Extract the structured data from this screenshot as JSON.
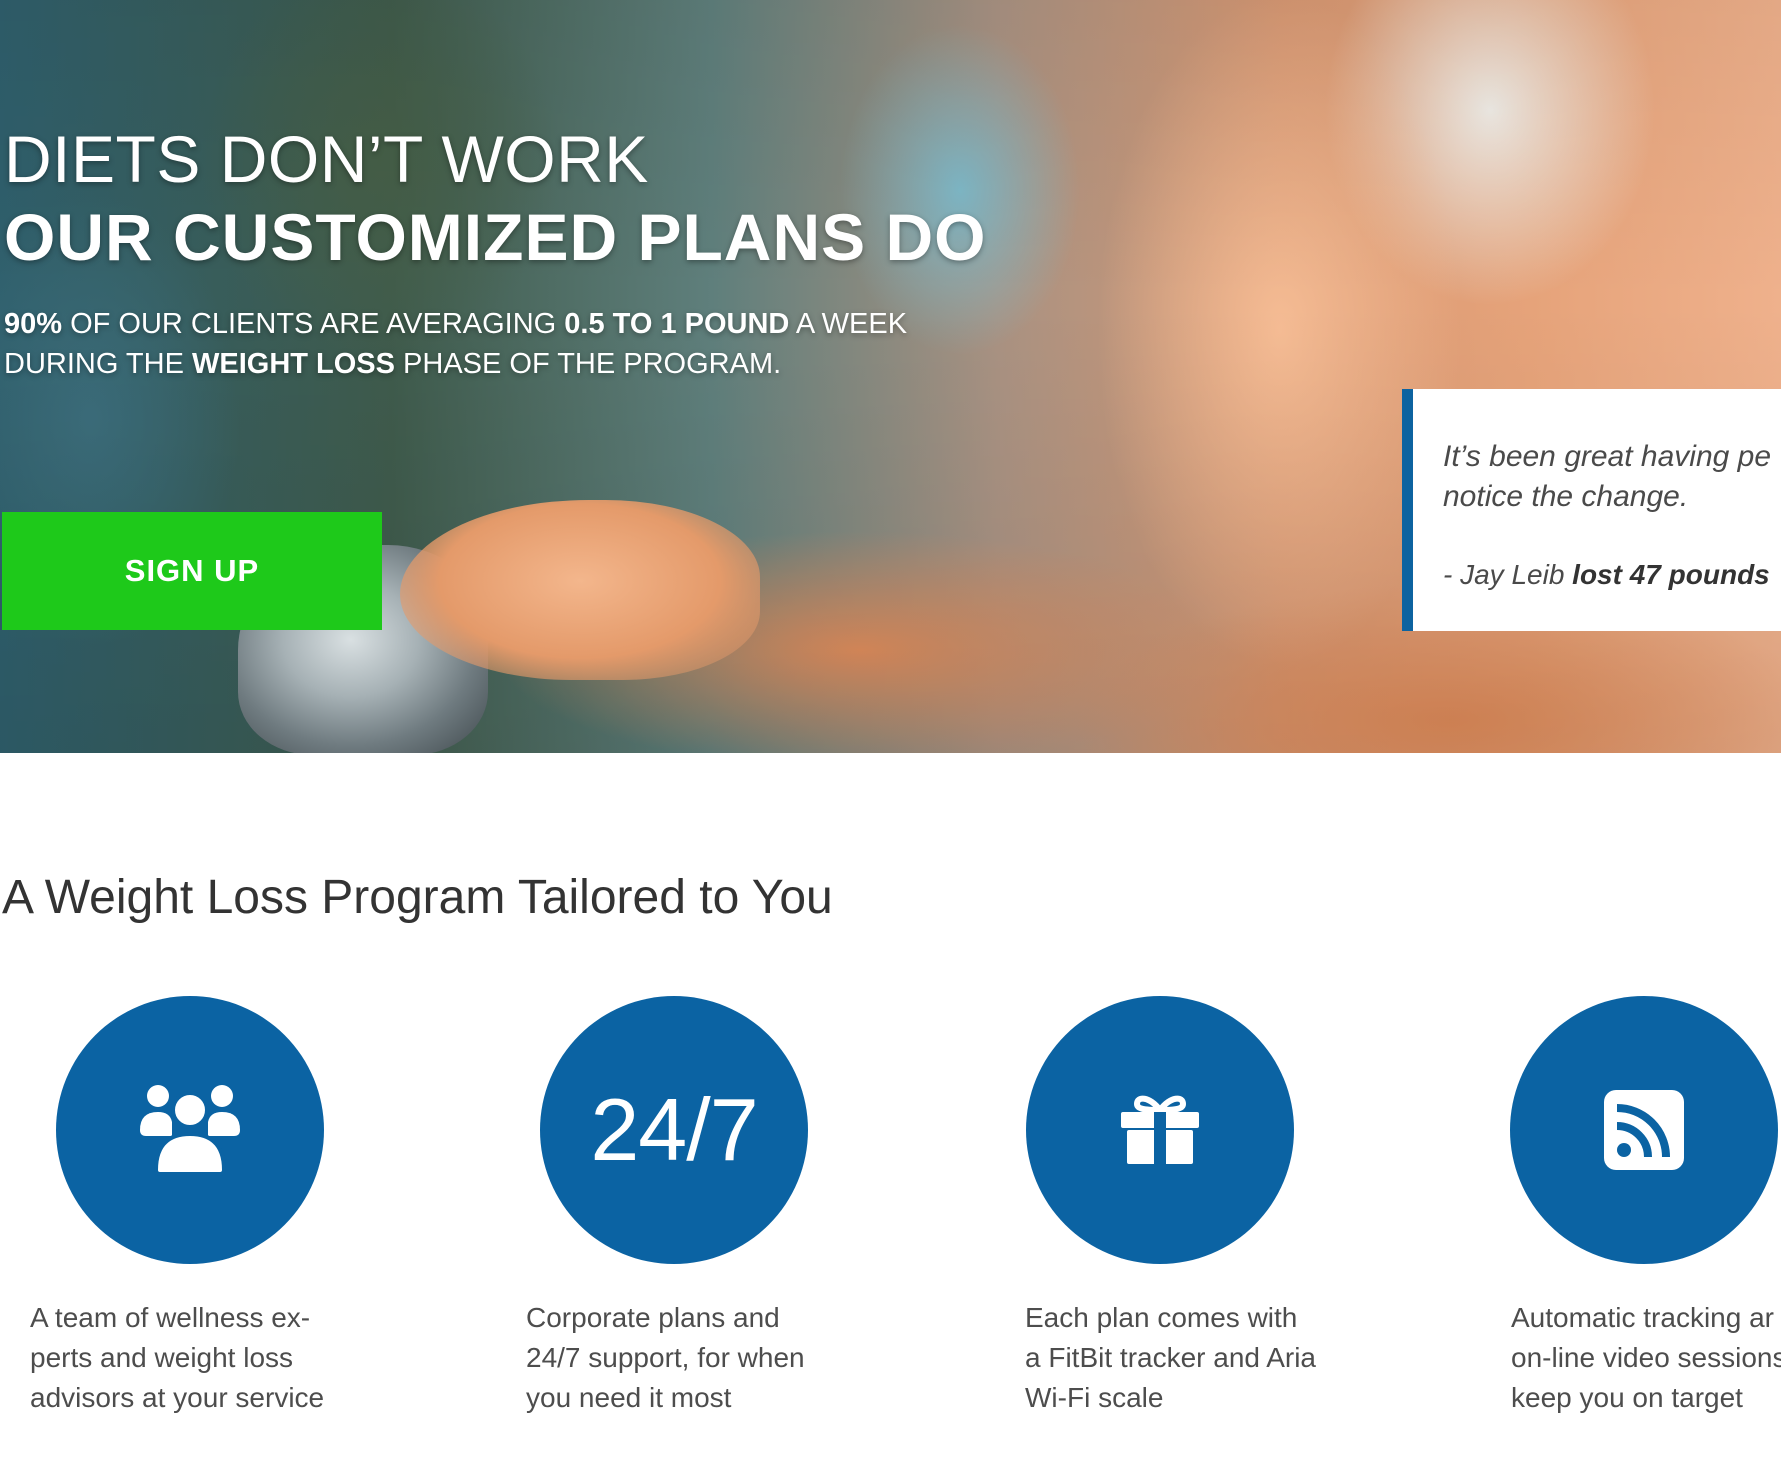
{
  "hero": {
    "headline_line1": "DIETS DON’T WORK",
    "headline_line2": "OUR CUSTOMIZED PLANS DO",
    "sub": {
      "l1_a": "90%",
      "l1_b": " OF OUR CLIENTS ARE AVERAGING ",
      "l1_c": "0.5 TO 1 POUND",
      "l1_d": " A WEEK",
      "l2_a": "DURING THE ",
      "l2_b": "WEIGHT LOSS",
      "l2_c": " PHASE OF THE PROGRAM."
    },
    "signup_label": "SIGN UP"
  },
  "testimonial": {
    "quote_line1": "It’s been great having pe",
    "quote_line2": "notice the change.",
    "author": "- Jay Leib ",
    "result": "lost 47 pounds"
  },
  "features": {
    "title": "A Weight Loss Program Tailored to You",
    "items": [
      {
        "icon": "users-icon",
        "lines": [
          "A team of wellness ex-",
          "perts and weight loss",
          "advisors at your service"
        ]
      },
      {
        "icon": "24-7-text",
        "circle_text": "24/7",
        "lines": [
          "Corporate plans and",
          "24/7 support, for when",
          "you need it most"
        ]
      },
      {
        "icon": "gift-icon",
        "lines": [
          "Each plan comes with",
          "a FitBit tracker and Aria",
          "Wi-Fi scale"
        ]
      },
      {
        "icon": "rss-icon",
        "lines": [
          "Automatic tracking ar",
          "on-line video sessions",
          "keep you on target"
        ]
      }
    ]
  },
  "colors": {
    "accent_blue": "#0b63a3",
    "signup_green": "#1ec91a",
    "testimonial_border": "#0d63a0"
  }
}
